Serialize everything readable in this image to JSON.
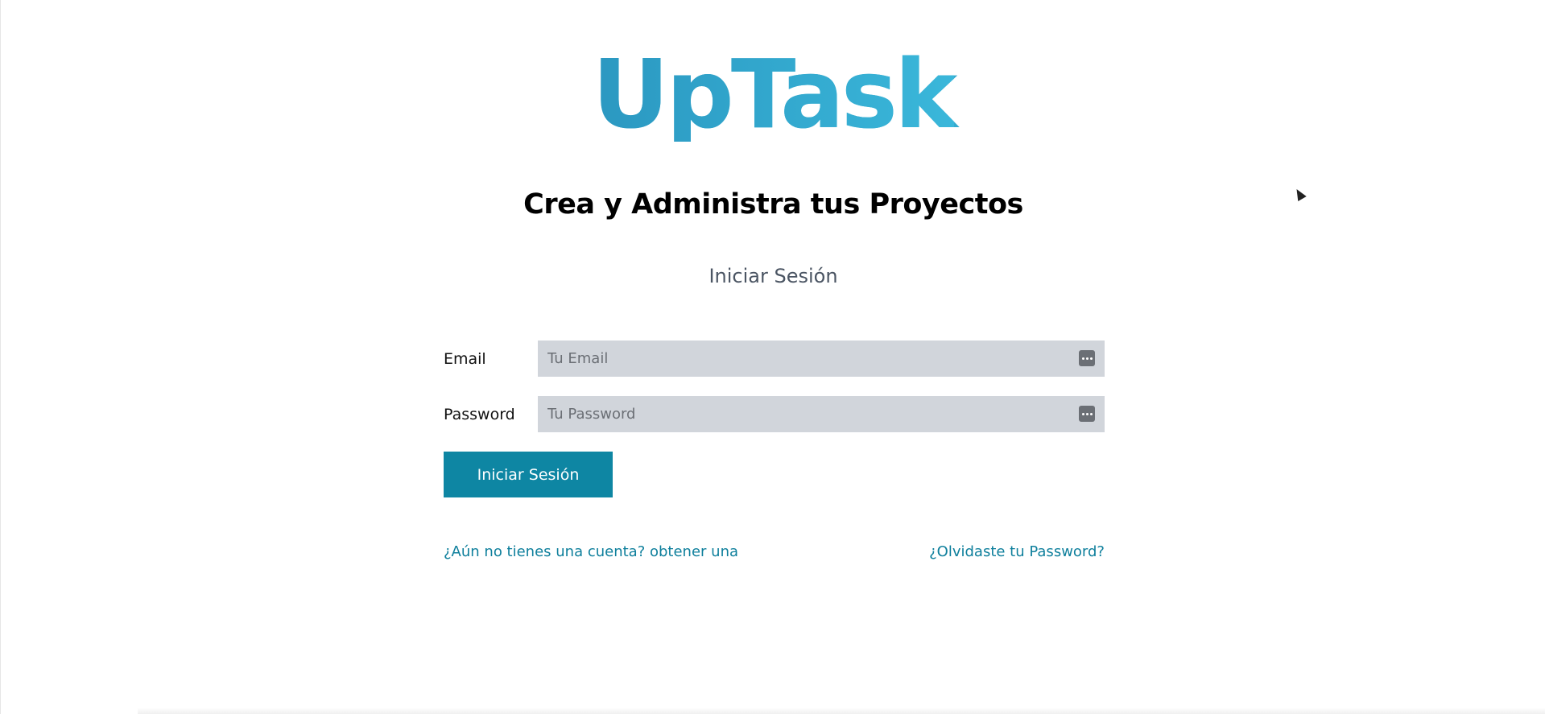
{
  "logo": {
    "text": "UpTask",
    "gradient_start": "#2b98c1",
    "gradient_end": "#3ab7da"
  },
  "tagline": "Crea y Administra tus Proyectos",
  "subtitle": "Iniciar Sesión",
  "form": {
    "email": {
      "label": "Email",
      "placeholder": "Tu Email",
      "value": ""
    },
    "password": {
      "label": "Password",
      "placeholder": "Tu Password",
      "value": ""
    },
    "submit_label": "Iniciar Sesión"
  },
  "links": {
    "register": "¿Aún no tienes una cuenta? obtener una",
    "forgot": "¿Olvidaste tu Password?"
  },
  "colors": {
    "accent": "#0e86a3",
    "link": "#0e7f9c",
    "input_bg": "#d1d5db"
  },
  "icons": {
    "autofill": "password-manager-key-icon",
    "cursor": "mouse-pointer-icon"
  }
}
